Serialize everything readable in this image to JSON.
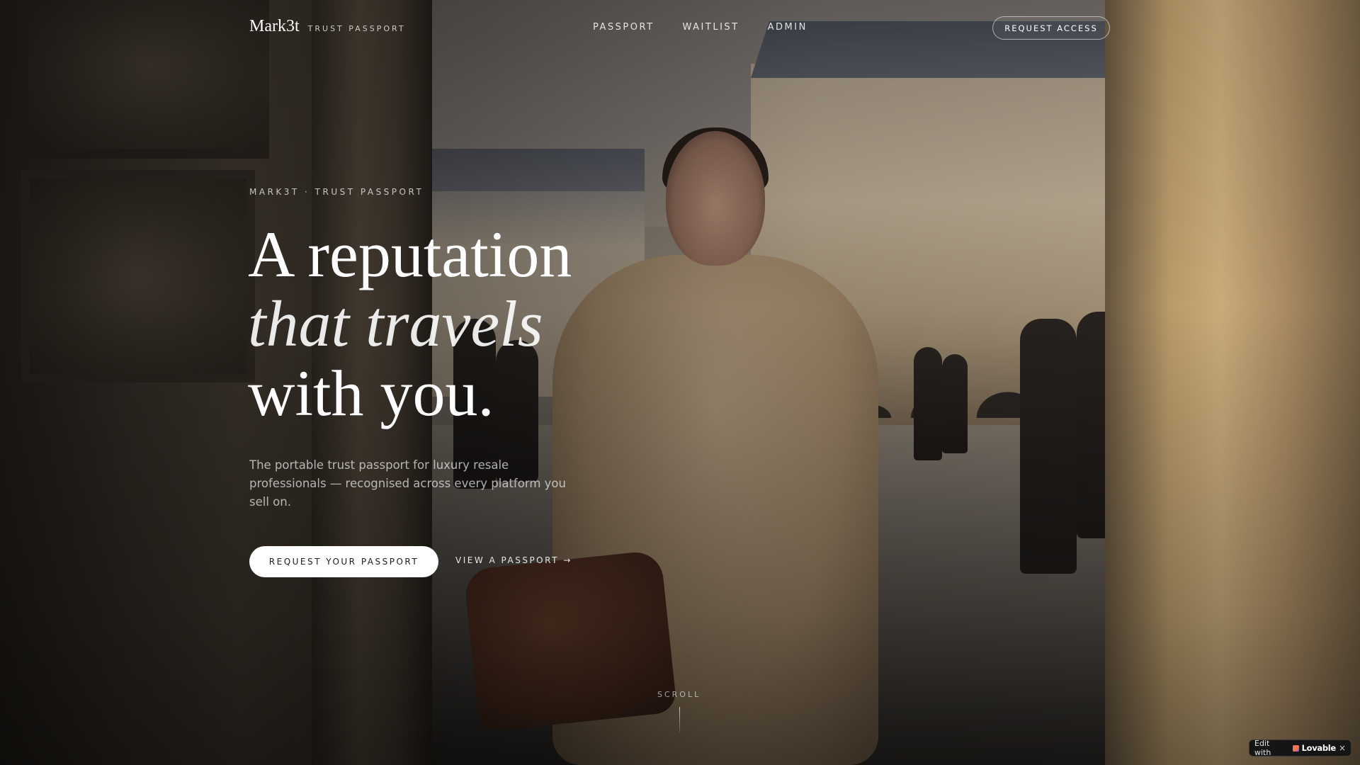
{
  "header": {
    "brand": "Mark3t",
    "brand_sub": "TRUST PASSPORT",
    "nav": [
      {
        "label": "PASSPORT"
      },
      {
        "label": "WAITLIST"
      },
      {
        "label": "ADMIN"
      }
    ],
    "cta": "REQUEST ACCESS"
  },
  "hero": {
    "eyebrow": "MARK3T · TRUST PASSPORT",
    "headline_line1": "A reputation",
    "headline_line2": "that travels",
    "headline_line3": "with you.",
    "subtext": "The portable trust passport for luxury resale professionals — recognised across every platform you sell on.",
    "primary_button": "REQUEST YOUR PASSPORT",
    "secondary_button": "VIEW A PASSPORT →",
    "scroll_label": "SCROLL",
    "background_image": "woman-walking-city-square-photo"
  },
  "badge": {
    "prefix": "Edit with",
    "brand": "Lovable",
    "close": "×"
  },
  "colors": {
    "text": "#ffffff",
    "button_bg": "#ffffff",
    "button_text": "#1c1c1c",
    "badge_bg": "#151515"
  }
}
